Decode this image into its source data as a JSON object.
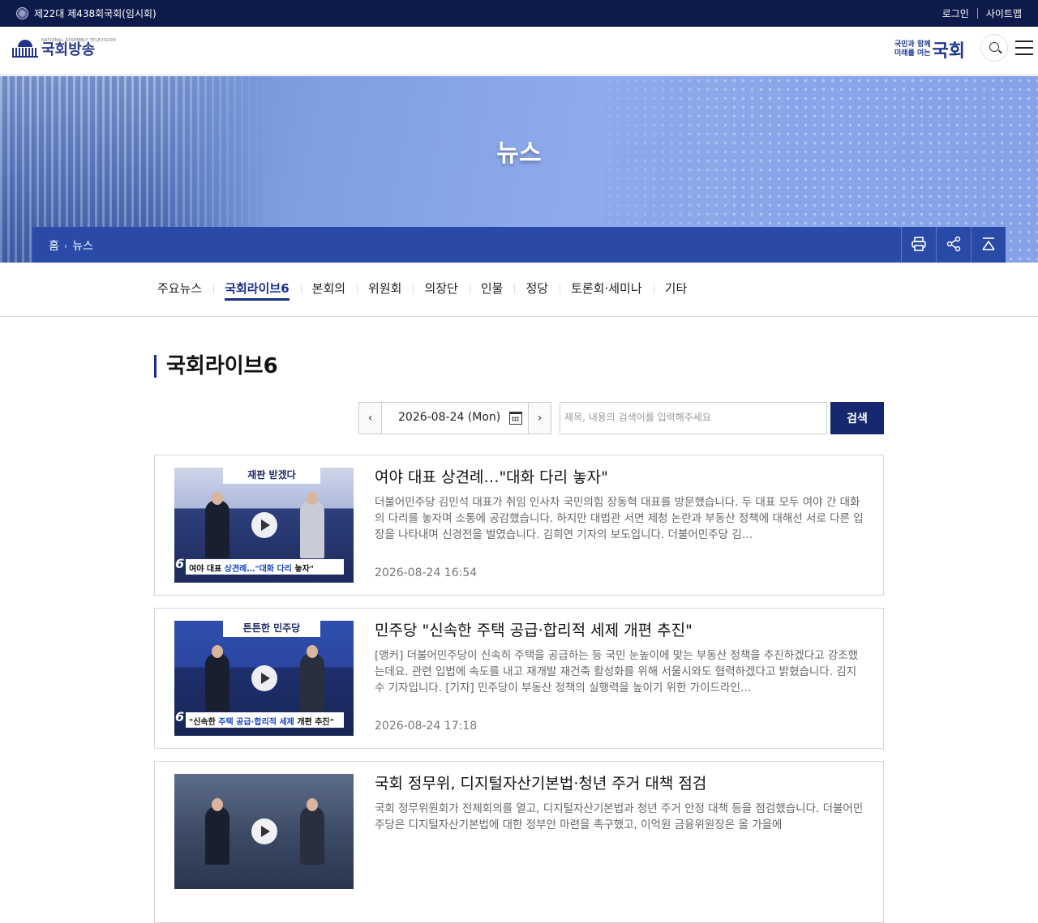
{
  "topbar": {
    "session": "제22대 제438회국회(임시회)",
    "login": "로그인",
    "sitemap": "사이트맵"
  },
  "header": {
    "logo_small": "NATIONAL ASSEMBLY TELEVISION",
    "logo_text": "국회방송",
    "slogan_line1": "국민과 함께",
    "slogan_line2": "미래를 여는",
    "slogan_big": "국회"
  },
  "hero": {
    "title": "뉴스"
  },
  "breadcrumb": {
    "home": "홈",
    "current": "뉴스"
  },
  "tabs": [
    "주요뉴스",
    "국회라이브6",
    "본회의",
    "위원회",
    "의장단",
    "인물",
    "정당",
    "토론회·세미나",
    "기타"
  ],
  "active_tab": "국회라이브6",
  "section": {
    "title": "국회라이브6"
  },
  "search": {
    "date": "2026-08-24 (Mon)",
    "placeholder": "제목, 내용의 검색어를 입력해주세요",
    "button": "검색"
  },
  "articles": [
    {
      "title": "여야 대표 상견례…\"대화 다리 놓자\"",
      "summary": "더불어민주당 김민석 대표가 취임 인사차 국민의힘 장동혁 대표를 방문했습니다. 두 대표 모두 여야 간 대화의 다리를 놓자며 소통에 공감했습니다. 하지만 대법관 서면 제청 논란과 부동산 정책에 대해선 서로 다른 입장을 나타내며 신경전을 벌였습니다. 김희연 기자의 보도입니다. 더불어민주당 김…",
      "time": "2026-08-24 16:54",
      "thumb_headline": "재판 받겠다",
      "thumb_caption_a": "여야 대표 ",
      "thumb_caption_b": "상견례…\"대화 다리",
      "thumb_caption_c": " 놓자\""
    },
    {
      "title": "민주당 \"신속한 주택 공급·합리적 세제 개편 추진\"",
      "summary": "[앵커] 더불어민주당이 신속히 주택을 공급하는 등 국민 눈높이에 맞는 부동산 정책을 추진하겠다고 강조했는데요. 관련 입법에 속도를 내고 재개발 재건축 활성화를 위해 서울시와도 협력하겠다고 밝혔습니다. 김지수 기자입니다. [기자] 민주당이 부동산 정책의 실행력을 높이기 위한 가이드라인…",
      "time": "2026-08-24 17:18",
      "thumb_headline": "튼튼한 민주당",
      "thumb_caption_a": "\"신속한 ",
      "thumb_caption_b": "주택 공급·합리적 세제",
      "thumb_caption_c": " 개편 추진\""
    },
    {
      "title": "국회 정무위, 디지털자산기본법·청년 주거 대책 점검",
      "summary": "국회 정무위원회가 전체회의를 열고, 디지털자산기본법과 청년 주거 안정 대책 등을 점검했습니다. 더불어민주당은 디지털자산기본법에 대한 정부안 마련을 촉구했고, 이억원 금융위원장은 올 가을에",
      "time": "",
      "thumb_headline": "",
      "thumb_caption_a": "",
      "thumb_caption_b": "",
      "thumb_caption_c": ""
    }
  ],
  "colors": {
    "navy": "#0d1a4a",
    "brand_blue": "#2a4aa8",
    "accent": "#1b2f8a"
  }
}
